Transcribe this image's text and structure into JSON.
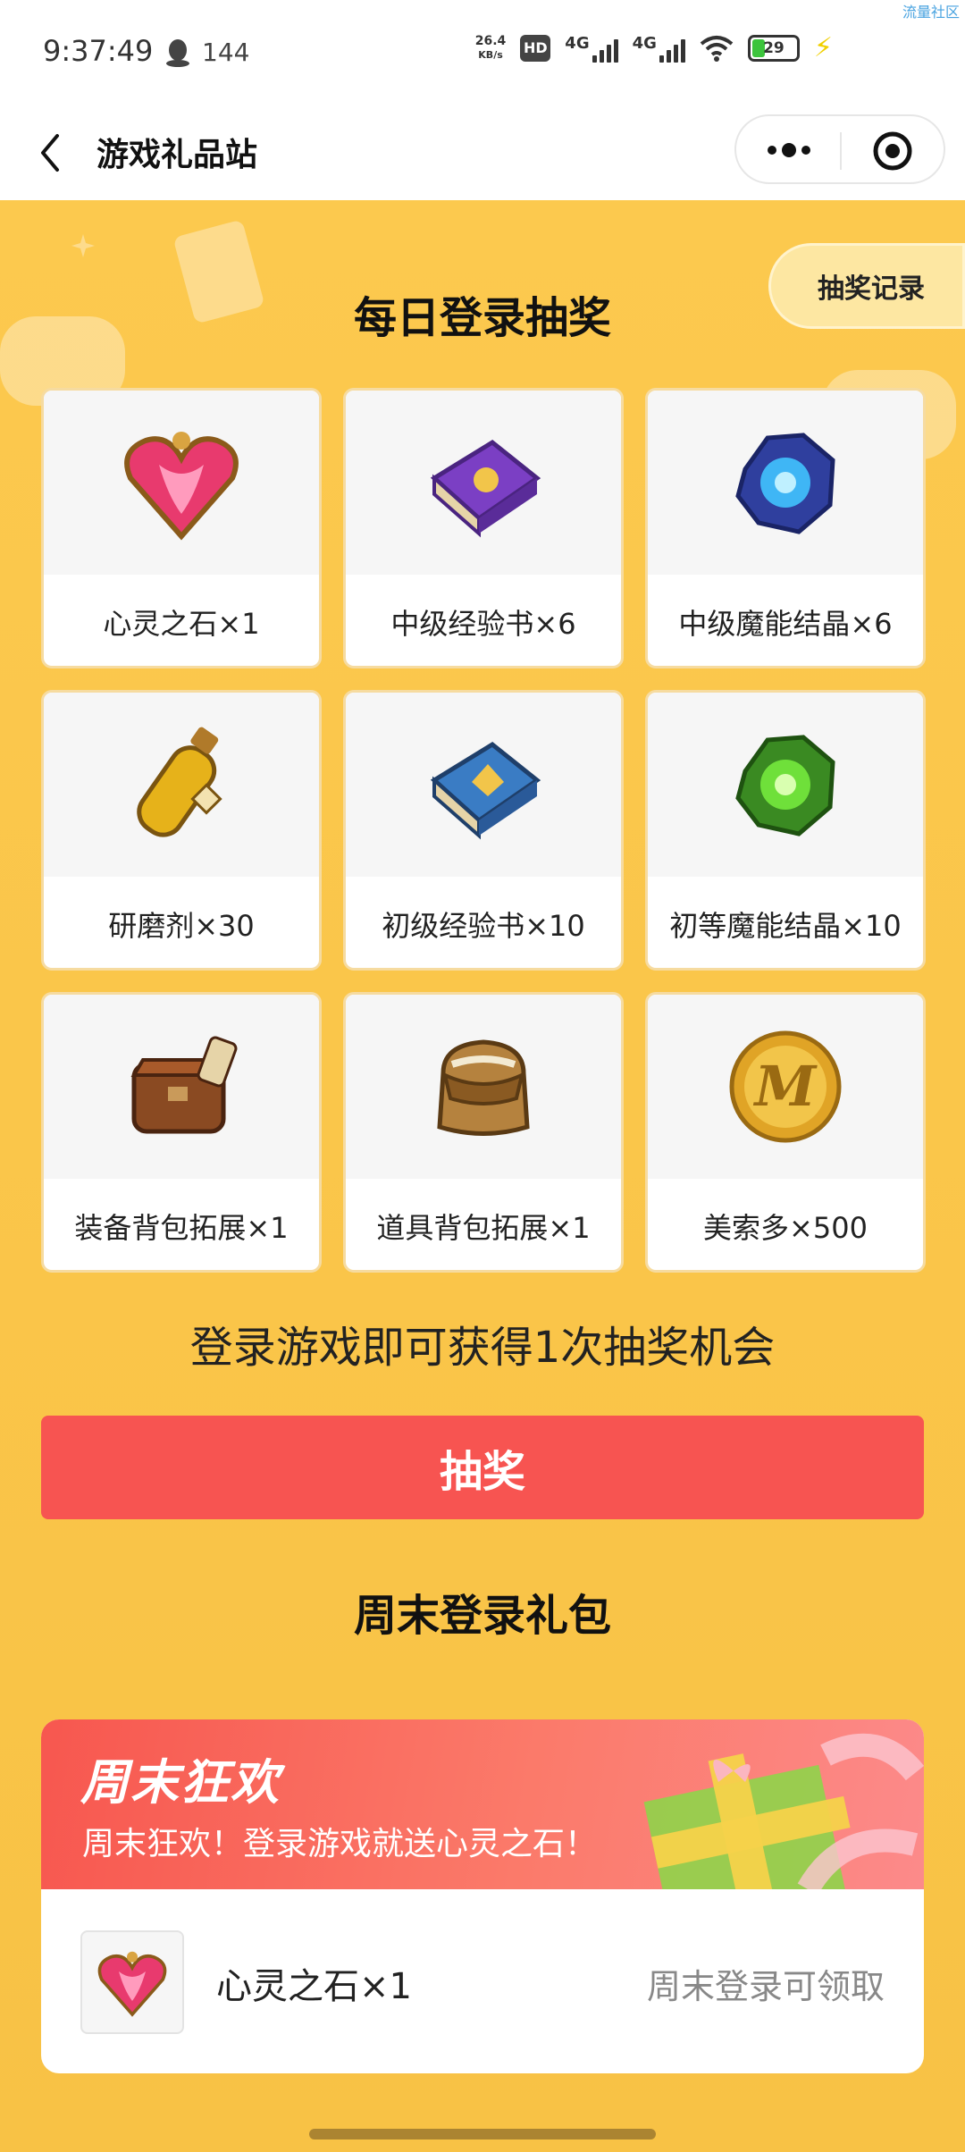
{
  "status_bar": {
    "time": "9:37:49",
    "notif_count": "144",
    "net_speed_value": "26.4",
    "net_speed_unit": "KB/s",
    "hd_label": "HD",
    "sim1_type": "4G",
    "sim2_type": "4G",
    "battery": "29",
    "icons": [
      "qq-icon",
      "hd-icon",
      "signal-icon",
      "wifi-icon",
      "battery-icon",
      "charging-icon"
    ]
  },
  "watermark": "流量社区",
  "nav": {
    "title": "游戏礼品站",
    "back_icon": "back-arrow-icon",
    "more_icon": "more-dots-icon",
    "close_icon": "target-close-icon"
  },
  "lottery": {
    "record_button": "抽奖记录",
    "title": "每日登录抽奖",
    "prizes": [
      {
        "label": "心灵之石×1",
        "icon": "heart-gem-icon"
      },
      {
        "label": "中级经验书×6",
        "icon": "purple-book-icon"
      },
      {
        "label": "中级魔能结晶×6",
        "icon": "blue-crystal-icon"
      },
      {
        "label": "研磨剂×30",
        "icon": "potion-bottle-icon"
      },
      {
        "label": "初级经验书×10",
        "icon": "blue-book-icon"
      },
      {
        "label": "初等魔能结晶×10",
        "icon": "green-crystal-icon"
      },
      {
        "label": "装备背包拓展×1",
        "icon": "brown-bag-icon"
      },
      {
        "label": "道具背包拓展×1",
        "icon": "backpack-icon"
      },
      {
        "label": "美索多×500",
        "icon": "gold-coin-icon"
      }
    ],
    "hint": "登录游戏即可获得1次抽奖机会",
    "draw_button": "抽奖"
  },
  "weekend": {
    "title": "周末登录礼包",
    "banner_title": "周末狂欢",
    "banner_subtitle": "周末狂欢！登录游戏就送心灵之石！",
    "item_name": "心灵之石×1",
    "item_status": "周末登录可领取"
  },
  "colors": {
    "background": "#fcc94e",
    "draw_button": "#f75451",
    "banner": "#f7574f"
  }
}
